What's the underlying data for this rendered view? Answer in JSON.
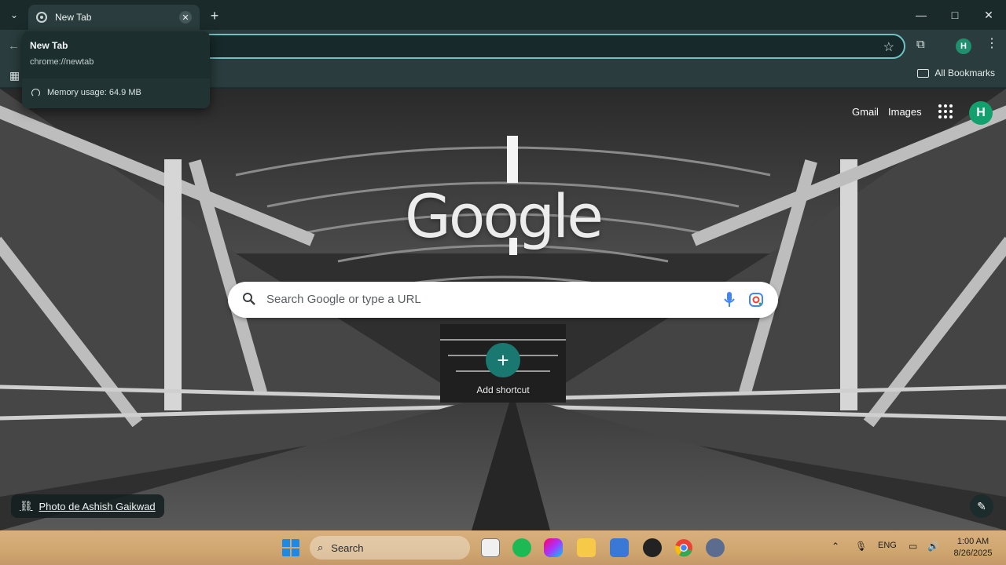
{
  "tab": {
    "title": "New Tab"
  },
  "hover_card": {
    "title": "New Tab",
    "url": "chrome://newtab",
    "memory": "Memory usage: 64.9 MB"
  },
  "window_controls": {
    "minimize": "—",
    "maximize": "□",
    "close": "✕"
  },
  "bookmarks_bar": {
    "all_bookmarks": "All Bookmarks"
  },
  "toolbar": {
    "profile_initial": "H"
  },
  "ntp": {
    "gmail": "Gmail",
    "images": "Images",
    "avatar_initial": "H",
    "logo": "Google",
    "search_placeholder": "Search Google or type a URL",
    "add_shortcut": "Add shortcut",
    "photo_credit": "Photo de Ashish Gaikwad"
  },
  "taskbar": {
    "search_label": "Search",
    "language": "ENG",
    "time": "1:00 AM",
    "date": "8/26/2025"
  },
  "colors": {
    "accent": "#6fc1c2",
    "shortcut": "#19786f",
    "avatar": "#12a06f"
  }
}
